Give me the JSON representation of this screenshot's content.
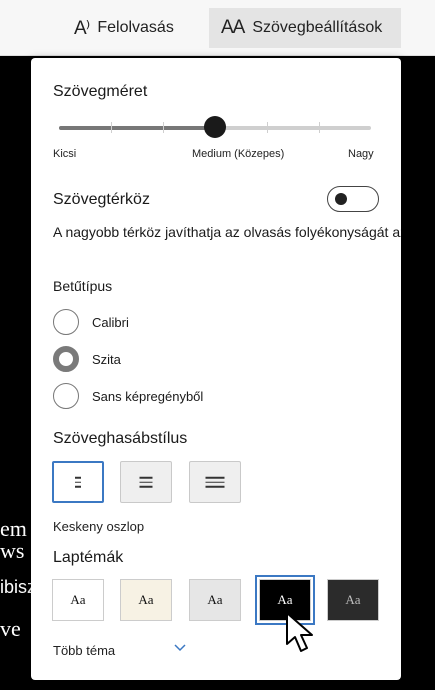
{
  "toolbar": {
    "read_aloud_icon": "A⁾",
    "read_aloud_label": "Felolvasás",
    "text_settings_icon": "AA",
    "text_settings_label": "Szövegbeállítások"
  },
  "background_text": [
    "em",
    "ws",
    "ibisz",
    "ve"
  ],
  "panel": {
    "text_size": {
      "heading": "Szövegméret",
      "min_label": "Kicsi",
      "mid_label": "Medium (Közepes)",
      "max_label": "Nagy",
      "value_fraction": 0.5
    },
    "spacing": {
      "heading": "Szövegtérköz",
      "enabled": false,
      "description": "A nagyobb térköz javíthatja az olvasás folyékonyságát az"
    },
    "font": {
      "heading": "Betűtípus",
      "options": [
        {
          "label": "Calibri",
          "selected": false
        },
        {
          "label": "Szita",
          "selected": true
        },
        {
          "label": "Sans képregényből",
          "selected": false
        }
      ]
    },
    "column": {
      "heading": "Szöveghasábstílus",
      "selected_label": "Keskeny oszlop"
    },
    "themes": {
      "heading": "Laptémák",
      "items": [
        {
          "label": "Aa",
          "bg": "#ffffff",
          "fg": "#111111",
          "selected": false
        },
        {
          "label": "Aa",
          "bg": "#f7f2e4",
          "fg": "#111111",
          "selected": false
        },
        {
          "label": "Aa",
          "bg": "#e6e6e6",
          "fg": "#111111",
          "selected": false
        },
        {
          "label": "Aa",
          "bg": "#000000",
          "fg": "#ffffff",
          "selected": true
        },
        {
          "label": "Aa",
          "bg": "#2b2b2b",
          "fg": "#bdbdbd",
          "selected": false
        }
      ],
      "more_label": "Több téma"
    }
  },
  "colors": {
    "accent": "#3b78c3"
  }
}
